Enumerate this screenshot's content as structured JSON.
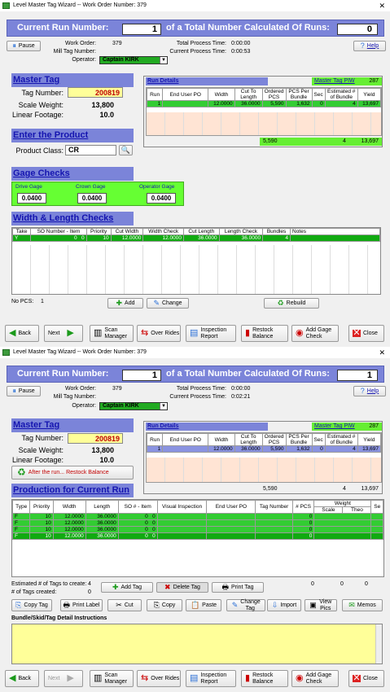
{
  "win1": {
    "title": "Level Master Tag Wizard -- Work Order Number: 379",
    "run_label": "Current Run Number:",
    "run_value": "1",
    "total_label": "of a Total Number Calculated Of Runs:",
    "total_value": "0",
    "pause": "Pause",
    "help": "Help",
    "work_order_label": "Work Order:",
    "work_order": "379",
    "mill_tag_label": "Mill Tag Number:",
    "operator_label": "Operator:",
    "operator": "Captain KIRK",
    "total_time_label": "Total Process Time:",
    "total_time": "0:00:00",
    "run_time_label": "Current Process Time:",
    "run_time": "0:00:53",
    "master_tag": "Master Tag",
    "tag_number_label": "Tag Number:",
    "tag_number": "200819",
    "scale_weight_label": "Scale Weight:",
    "scale_weight": "13,800",
    "linear_footage_label": "Linear Footage:",
    "linear_footage": "10.0",
    "enter_product": "Enter the Product",
    "product_class_label": "Product Class:",
    "product_class": "CR",
    "gage_checks": "Gage Checks",
    "drive_gage_label": "Drive Gage",
    "drive_gage": "0.0400",
    "crown_gage_label": "Crown Gage",
    "crown_gage": "0.0400",
    "operator_gage_label": "Operator Gage",
    "operator_gage": "0.0400",
    "width_length": "Width & Length Checks",
    "wl_headers": [
      "Take",
      "SO Number - Item",
      "Priority",
      "Cut Width",
      "Width Check",
      "Cut Length",
      "Length Check",
      "Bundles",
      "Notes"
    ],
    "wl_row": [
      "Y",
      "0",
      "0",
      "10",
      "12.0000",
      "12.0000",
      "36.0000",
      "36.0000",
      "4",
      ""
    ],
    "no_pcs_label": "No PCS:",
    "no_pcs": "1",
    "add": "Add",
    "change": "Change",
    "rebuild": "Rebuild",
    "nav": {
      "back": "Back",
      "next": "Next",
      "scan": "Scan Manager",
      "over": "Over Rides",
      "insp": "Inspection Report",
      "restock": "Restock Balance",
      "gage": "Add Gage Check",
      "close": "Close"
    }
  },
  "run_details": {
    "title": "Run Details",
    "piw_label": "Master Tag PIW",
    "piw_value": "287",
    "headers": [
      "Run",
      "End User PO",
      "Width",
      "Cut To Length",
      "Ordered PCS",
      "PCS Per Bundle",
      "Sec",
      "Estimated # of Bundle",
      "Yield"
    ],
    "row": [
      "1",
      "",
      "12.0000",
      "36.0000",
      "5,590",
      "1,632",
      "0",
      "4",
      "13,697"
    ],
    "totals": [
      "5,590",
      "4",
      "13,697"
    ]
  },
  "win2": {
    "title": "Level Master Tag Wizard -- Work Order Number: 379",
    "run_value": "1",
    "total_value": "1",
    "run_time": "0:02:21",
    "total_time": "0:00:00",
    "restock_note": "After the run... Restock Balance",
    "production": "Production for Current Run",
    "prod_headers": [
      "Type",
      "Priority",
      "Width",
      "Length",
      "SO # - Item",
      "Visual Inspection",
      "End User PO",
      "Tag Number",
      "# PCS",
      "Weight",
      "Se"
    ],
    "weight_sub": [
      "Scale",
      "Theo"
    ],
    "prod_rows": [
      [
        "F",
        "10",
        "12.0000",
        "36.0000",
        "0",
        "0",
        "",
        "",
        "0",
        "",
        ""
      ],
      [
        "F",
        "10",
        "12.0000",
        "36.0000",
        "0",
        "0",
        "",
        "",
        "0",
        "",
        ""
      ],
      [
        "F",
        "10",
        "12.0000",
        "36.0000",
        "0",
        "0",
        "",
        "",
        "0",
        "",
        ""
      ],
      [
        "F",
        "10",
        "12.0000",
        "36.0000",
        "0",
        "0",
        "",
        "",
        "0",
        "",
        ""
      ]
    ],
    "est_tags_label": "Estimated # of Tags to create:",
    "est_tags": "4",
    "tags_created_label": "# of Tags created:",
    "tags_created": "0",
    "sum_pcs": "0",
    "sum_scale": "0",
    "sum_theo": "0",
    "add_tag": "Add Tag",
    "delete_tag": "Delete Tag",
    "print_tag": "Print Tag",
    "copy_tag": "Copy Tag",
    "print_label": "Print Label",
    "cut": "Cut",
    "copy": "Copy",
    "paste": "Paste",
    "change_tag": "Change Tag",
    "import": "Import",
    "view_pics": "View Pics",
    "memos": "Memos",
    "instructions_label": "Bundle/Skid/Tag Detail Instructions"
  }
}
